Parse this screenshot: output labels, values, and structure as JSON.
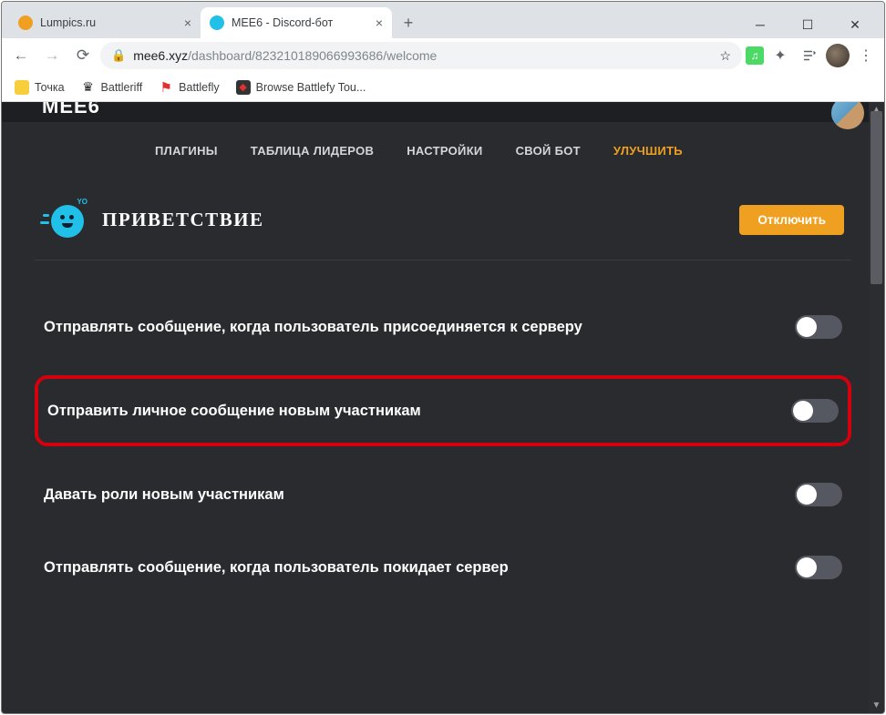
{
  "window": {
    "tabs": [
      {
        "title": "Lumpics.ru",
        "fav_color": "#f0a020",
        "active": false
      },
      {
        "title": "MEE6 - Discord-бот",
        "fav_color": "#20c0e8",
        "active": true
      }
    ]
  },
  "addressbar": {
    "host": "mee6.xyz",
    "path": "/dashboard/823210189066993686/welcome"
  },
  "bookmarks": [
    {
      "label": "Точка"
    },
    {
      "label": "Battleriff"
    },
    {
      "label": "Battlefly"
    },
    {
      "label": "Browse Battlefy Tou..."
    }
  ],
  "page": {
    "logo": "MEE6",
    "nav": [
      {
        "label": "ПЛАГИНЫ",
        "active": false
      },
      {
        "label": "ТАБЛИЦА ЛИДЕРОВ",
        "active": false
      },
      {
        "label": "НАСТРОЙКИ",
        "active": false
      },
      {
        "label": "СВОЙ БОТ",
        "active": false
      },
      {
        "label": "УЛУЧШИТЬ",
        "active": true
      }
    ],
    "section_title": "ПРИВЕТСТВИЕ",
    "disable_button": "Отключить",
    "options": [
      {
        "label": "Отправлять сообщение, когда пользователь присоединяется к серверу",
        "enabled": false,
        "highlight": false
      },
      {
        "label": "Отправить личное сообщение новым участникам",
        "enabled": false,
        "highlight": true
      },
      {
        "label": "Давать роли новым участникам",
        "enabled": false,
        "highlight": false
      },
      {
        "label": "Отправлять сообщение, когда пользователь покидает сервер",
        "enabled": false,
        "highlight": false
      }
    ]
  }
}
